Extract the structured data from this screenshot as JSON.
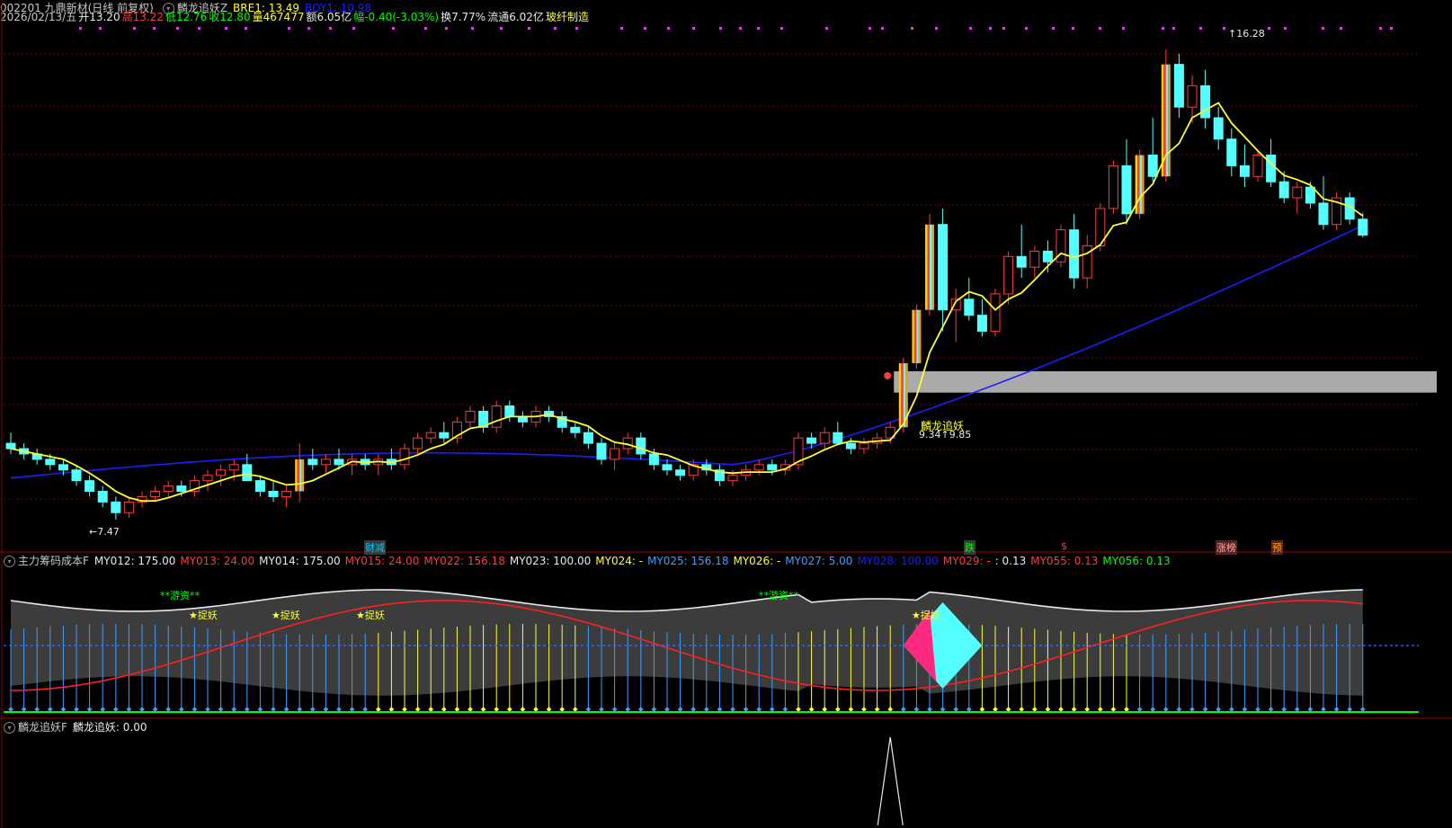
{
  "header": {
    "code_name": "002201 九鼎新材(日线 前复权)",
    "indicator": "麟龙追妖Z",
    "bre": "BRE1: 13.49",
    "boy": "BOY1: 10.98",
    "date": "2026/02/13/五",
    "open": "开13.20",
    "high": "高13.22",
    "low": "低12.76",
    "close": "收12.80",
    "vol": "量467477",
    "amount": "额6.05亿",
    "change": "幅-0.40(-3.03%)",
    "turnover": "换7.77%",
    "float_cap": "流通6.02亿",
    "sector": "玻纤制造"
  },
  "colors": {
    "bg": "#000000",
    "up": "#ff3b3b",
    "down": "#54ffff",
    "ma_fast": "#ffff33",
    "ma_slow": "#1d1dff",
    "grid": "#7a0000",
    "zone": "#c8c8c8",
    "green": "#00ff00",
    "white": "#e8e8e8"
  },
  "main_labels": {
    "peak": "16.28",
    "trough": "7.47",
    "signal": "麟龙追妖",
    "signal_vals": "9.34↑9.85",
    "ev1": "财减",
    "ev2": "跌",
    "ev3": "$",
    "ev4": "涨榜",
    "ev5": "预"
  },
  "panel2": {
    "title": "主力筹码成本F",
    "items": [
      {
        "k": "MY012: 175.00",
        "c": "#e8e8e8"
      },
      {
        "k": "MY013: 24.00",
        "c": "#ff3b3b"
      },
      {
        "k": "MY014: 175.00",
        "c": "#e8e8e8"
      },
      {
        "k": "MY015: 24.00",
        "c": "#ff3b3b"
      },
      {
        "k": "MY022: 156.18",
        "c": "#ff3b3b"
      },
      {
        "k": "MY023: 100.00",
        "c": "#e8e8e8"
      },
      {
        "k": "MY024: -",
        "c": "#ffff33"
      },
      {
        "k": "MY025: 156.18",
        "c": "#3aa0ff"
      },
      {
        "k": "MY026: -",
        "c": "#ffff33"
      },
      {
        "k": "MY027: 5.00",
        "c": "#3aa0ff"
      },
      {
        "k": "MY028: 100.00",
        "c": "#1d1dff"
      },
      {
        "k": "MY029: -",
        "c": "#ff3b3b"
      },
      {
        "k": ": 0.13",
        "c": "#e8e8e8"
      },
      {
        "k": "MY055: 0.13",
        "c": "#ff3b3b"
      },
      {
        "k": "MY056: 0.13",
        "c": "#00ff00"
      }
    ],
    "tags": {
      "youzi": "**游资**",
      "zhuoyao": "★捉妖",
      "zhuoyao_short": "★捉",
      "luo": "★揭"
    }
  },
  "panel3": {
    "title": "麟龙追妖F",
    "value": "麟龙追妖: 0.00"
  },
  "chart_data": {
    "type": "candlestick",
    "candles": [
      [
        8.9,
        9.1,
        8.7,
        8.8
      ],
      [
        8.8,
        8.9,
        8.6,
        8.7
      ],
      [
        8.7,
        8.8,
        8.5,
        8.6
      ],
      [
        8.6,
        8.7,
        8.4,
        8.5
      ],
      [
        8.5,
        8.6,
        8.3,
        8.4
      ],
      [
        8.4,
        8.5,
        8.1,
        8.2
      ],
      [
        8.2,
        8.3,
        7.9,
        8.0
      ],
      [
        8.0,
        8.1,
        7.7,
        7.8
      ],
      [
        7.8,
        7.9,
        7.47,
        7.6
      ],
      [
        7.6,
        7.9,
        7.5,
        7.8
      ],
      [
        7.8,
        8.0,
        7.7,
        7.9
      ],
      [
        7.9,
        8.1,
        7.8,
        8.0
      ],
      [
        8.0,
        8.2,
        7.9,
        8.1
      ],
      [
        8.1,
        8.2,
        7.9,
        8.0
      ],
      [
        8.0,
        8.3,
        7.9,
        8.2
      ],
      [
        8.2,
        8.4,
        8.0,
        8.3
      ],
      [
        8.3,
        8.5,
        8.1,
        8.4
      ],
      [
        8.4,
        8.6,
        8.2,
        8.5
      ],
      [
        8.5,
        8.7,
        8.3,
        8.2
      ],
      [
        8.2,
        8.3,
        7.9,
        8.0
      ],
      [
        8.0,
        8.2,
        7.8,
        7.9
      ],
      [
        7.9,
        8.1,
        7.7,
        8.0
      ],
      [
        8.0,
        8.9,
        7.8,
        8.6
      ],
      [
        8.6,
        8.8,
        8.4,
        8.5
      ],
      [
        8.5,
        8.7,
        8.3,
        8.6
      ],
      [
        8.6,
        8.8,
        8.4,
        8.5
      ],
      [
        8.5,
        8.7,
        8.3,
        8.6
      ],
      [
        8.6,
        8.7,
        8.4,
        8.5
      ],
      [
        8.5,
        8.7,
        8.3,
        8.6
      ],
      [
        8.6,
        8.8,
        8.4,
        8.5
      ],
      [
        8.5,
        8.9,
        8.4,
        8.8
      ],
      [
        8.8,
        9.1,
        8.7,
        9.0
      ],
      [
        9.0,
        9.2,
        8.9,
        9.1
      ],
      [
        9.1,
        9.3,
        8.9,
        9.0
      ],
      [
        9.0,
        9.4,
        8.9,
        9.3
      ],
      [
        9.3,
        9.6,
        9.2,
        9.5
      ],
      [
        9.5,
        9.6,
        9.1,
        9.2
      ],
      [
        9.2,
        9.7,
        9.1,
        9.6
      ],
      [
        9.6,
        9.7,
        9.3,
        9.4
      ],
      [
        9.4,
        9.5,
        9.2,
        9.3
      ],
      [
        9.3,
        9.6,
        9.2,
        9.5
      ],
      [
        9.5,
        9.6,
        9.3,
        9.4
      ],
      [
        9.4,
        9.5,
        9.1,
        9.2
      ],
      [
        9.2,
        9.3,
        9.0,
        9.1
      ],
      [
        9.1,
        9.2,
        8.8,
        8.9
      ],
      [
        8.9,
        9.0,
        8.5,
        8.6
      ],
      [
        8.6,
        8.9,
        8.4,
        8.8
      ],
      [
        8.8,
        9.1,
        8.7,
        9.0
      ],
      [
        9.0,
        9.1,
        8.6,
        8.7
      ],
      [
        8.7,
        8.8,
        8.4,
        8.5
      ],
      [
        8.5,
        8.6,
        8.3,
        8.4
      ],
      [
        8.4,
        8.5,
        8.2,
        8.3
      ],
      [
        8.3,
        8.6,
        8.2,
        8.5
      ],
      [
        8.5,
        8.6,
        8.3,
        8.4
      ],
      [
        8.4,
        8.5,
        8.1,
        8.2
      ],
      [
        8.2,
        8.4,
        8.1,
        8.3
      ],
      [
        8.3,
        8.5,
        8.2,
        8.4
      ],
      [
        8.4,
        8.6,
        8.3,
        8.5
      ],
      [
        8.5,
        8.6,
        8.3,
        8.4
      ],
      [
        8.4,
        8.6,
        8.3,
        8.5
      ],
      [
        8.5,
        9.1,
        8.4,
        9.0
      ],
      [
        9.0,
        9.1,
        8.8,
        8.9
      ],
      [
        8.9,
        9.2,
        8.8,
        9.1
      ],
      [
        9.1,
        9.3,
        8.9,
        8.9
      ],
      [
        8.9,
        9.0,
        8.7,
        8.8
      ],
      [
        8.8,
        9.0,
        8.7,
        8.9
      ],
      [
        8.9,
        9.1,
        8.8,
        9.0
      ],
      [
        9.0,
        9.3,
        8.9,
        9.2
      ],
      [
        9.2,
        10.5,
        9.1,
        10.4
      ],
      [
        10.4,
        11.5,
        10.3,
        11.4
      ],
      [
        11.4,
        13.2,
        11.3,
        13.0
      ],
      [
        13.0,
        13.3,
        11.0,
        11.4
      ],
      [
        11.4,
        11.8,
        10.8,
        11.6
      ],
      [
        11.6,
        12.0,
        11.2,
        11.3
      ],
      [
        11.3,
        11.6,
        10.9,
        11.0
      ],
      [
        11.0,
        11.8,
        10.9,
        11.7
      ],
      [
        11.7,
        12.5,
        11.5,
        12.4
      ],
      [
        12.4,
        13.0,
        12.0,
        12.2
      ],
      [
        12.2,
        12.6,
        12.0,
        12.5
      ],
      [
        12.5,
        12.7,
        12.1,
        12.3
      ],
      [
        12.3,
        13.0,
        12.2,
        12.9
      ],
      [
        12.9,
        13.2,
        11.8,
        12.0
      ],
      [
        12.0,
        12.8,
        11.8,
        12.6
      ],
      [
        12.6,
        13.4,
        12.5,
        13.3
      ],
      [
        13.3,
        14.2,
        13.2,
        14.1
      ],
      [
        14.1,
        14.6,
        13.0,
        13.2
      ],
      [
        13.2,
        14.4,
        13.1,
        14.3
      ],
      [
        14.3,
        15.0,
        13.8,
        13.9
      ],
      [
        13.9,
        16.28,
        13.8,
        16.0
      ],
      [
        16.0,
        16.2,
        15.0,
        15.2
      ],
      [
        15.2,
        15.8,
        14.9,
        15.6
      ],
      [
        15.6,
        15.9,
        14.8,
        15.0
      ],
      [
        15.0,
        15.2,
        14.4,
        14.6
      ],
      [
        14.6,
        14.8,
        13.9,
        14.1
      ],
      [
        14.1,
        14.5,
        13.7,
        13.9
      ],
      [
        13.9,
        14.4,
        13.8,
        14.3
      ],
      [
        14.3,
        14.6,
        13.7,
        13.8
      ],
      [
        13.8,
        14.0,
        13.4,
        13.5
      ],
      [
        13.5,
        13.8,
        13.2,
        13.7
      ],
      [
        13.7,
        13.8,
        13.3,
        13.4
      ],
      [
        13.4,
        13.9,
        12.9,
        13.0
      ],
      [
        13.0,
        13.6,
        12.9,
        13.5
      ],
      [
        13.5,
        13.6,
        13.0,
        13.1
      ],
      [
        13.1,
        13.22,
        12.76,
        12.8
      ]
    ],
    "ma_fast_note": "computed MA5",
    "ma_slow_note": "computed MA60",
    "zone": [
      9.85,
      10.25
    ],
    "ylim": [
      7.2,
      16.6
    ]
  }
}
